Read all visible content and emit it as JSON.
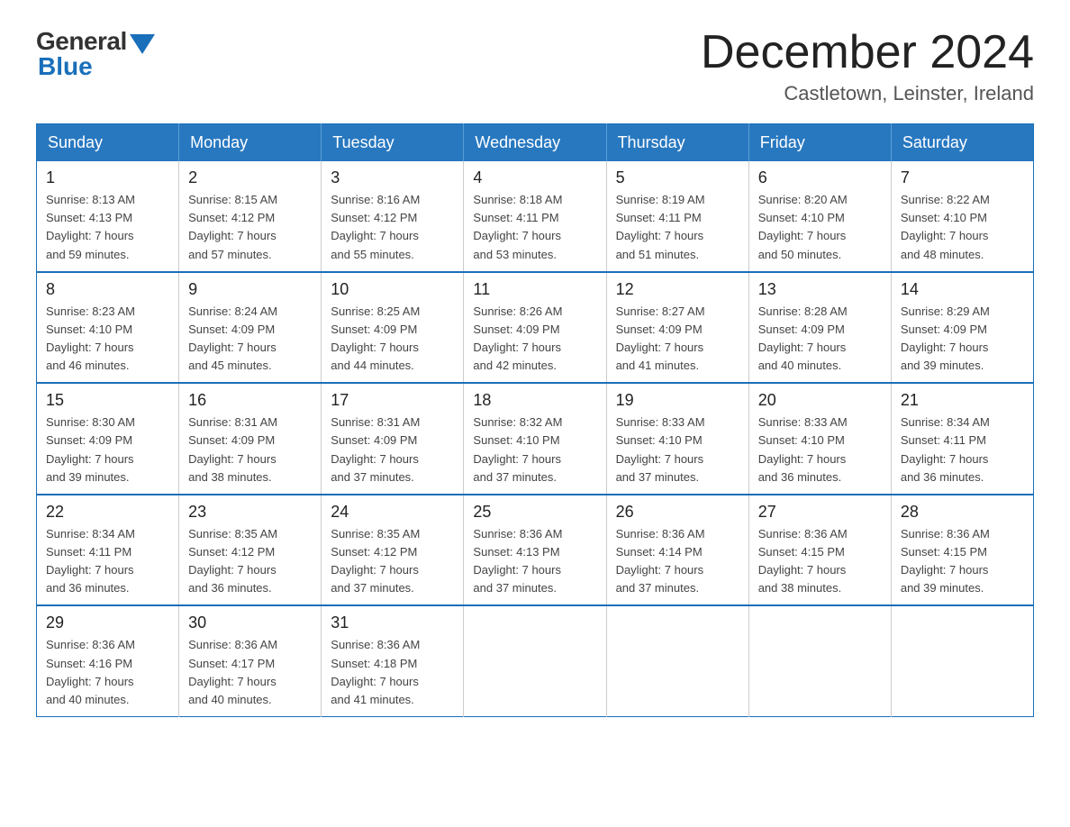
{
  "logo": {
    "general": "General",
    "blue": "Blue"
  },
  "header": {
    "month_year": "December 2024",
    "location": "Castletown, Leinster, Ireland"
  },
  "weekdays": [
    "Sunday",
    "Monday",
    "Tuesday",
    "Wednesday",
    "Thursday",
    "Friday",
    "Saturday"
  ],
  "weeks": [
    [
      {
        "day": "1",
        "sunrise": "8:13 AM",
        "sunset": "4:13 PM",
        "daylight": "7 hours and 59 minutes."
      },
      {
        "day": "2",
        "sunrise": "8:15 AM",
        "sunset": "4:12 PM",
        "daylight": "7 hours and 57 minutes."
      },
      {
        "day": "3",
        "sunrise": "8:16 AM",
        "sunset": "4:12 PM",
        "daylight": "7 hours and 55 minutes."
      },
      {
        "day": "4",
        "sunrise": "8:18 AM",
        "sunset": "4:11 PM",
        "daylight": "7 hours and 53 minutes."
      },
      {
        "day": "5",
        "sunrise": "8:19 AM",
        "sunset": "4:11 PM",
        "daylight": "7 hours and 51 minutes."
      },
      {
        "day": "6",
        "sunrise": "8:20 AM",
        "sunset": "4:10 PM",
        "daylight": "7 hours and 50 minutes."
      },
      {
        "day": "7",
        "sunrise": "8:22 AM",
        "sunset": "4:10 PM",
        "daylight": "7 hours and 48 minutes."
      }
    ],
    [
      {
        "day": "8",
        "sunrise": "8:23 AM",
        "sunset": "4:10 PM",
        "daylight": "7 hours and 46 minutes."
      },
      {
        "day": "9",
        "sunrise": "8:24 AM",
        "sunset": "4:09 PM",
        "daylight": "7 hours and 45 minutes."
      },
      {
        "day": "10",
        "sunrise": "8:25 AM",
        "sunset": "4:09 PM",
        "daylight": "7 hours and 44 minutes."
      },
      {
        "day": "11",
        "sunrise": "8:26 AM",
        "sunset": "4:09 PM",
        "daylight": "7 hours and 42 minutes."
      },
      {
        "day": "12",
        "sunrise": "8:27 AM",
        "sunset": "4:09 PM",
        "daylight": "7 hours and 41 minutes."
      },
      {
        "day": "13",
        "sunrise": "8:28 AM",
        "sunset": "4:09 PM",
        "daylight": "7 hours and 40 minutes."
      },
      {
        "day": "14",
        "sunrise": "8:29 AM",
        "sunset": "4:09 PM",
        "daylight": "7 hours and 39 minutes."
      }
    ],
    [
      {
        "day": "15",
        "sunrise": "8:30 AM",
        "sunset": "4:09 PM",
        "daylight": "7 hours and 39 minutes."
      },
      {
        "day": "16",
        "sunrise": "8:31 AM",
        "sunset": "4:09 PM",
        "daylight": "7 hours and 38 minutes."
      },
      {
        "day": "17",
        "sunrise": "8:31 AM",
        "sunset": "4:09 PM",
        "daylight": "7 hours and 37 minutes."
      },
      {
        "day": "18",
        "sunrise": "8:32 AM",
        "sunset": "4:10 PM",
        "daylight": "7 hours and 37 minutes."
      },
      {
        "day": "19",
        "sunrise": "8:33 AM",
        "sunset": "4:10 PM",
        "daylight": "7 hours and 37 minutes."
      },
      {
        "day": "20",
        "sunrise": "8:33 AM",
        "sunset": "4:10 PM",
        "daylight": "7 hours and 36 minutes."
      },
      {
        "day": "21",
        "sunrise": "8:34 AM",
        "sunset": "4:11 PM",
        "daylight": "7 hours and 36 minutes."
      }
    ],
    [
      {
        "day": "22",
        "sunrise": "8:34 AM",
        "sunset": "4:11 PM",
        "daylight": "7 hours and 36 minutes."
      },
      {
        "day": "23",
        "sunrise": "8:35 AM",
        "sunset": "4:12 PM",
        "daylight": "7 hours and 36 minutes."
      },
      {
        "day": "24",
        "sunrise": "8:35 AM",
        "sunset": "4:12 PM",
        "daylight": "7 hours and 37 minutes."
      },
      {
        "day": "25",
        "sunrise": "8:36 AM",
        "sunset": "4:13 PM",
        "daylight": "7 hours and 37 minutes."
      },
      {
        "day": "26",
        "sunrise": "8:36 AM",
        "sunset": "4:14 PM",
        "daylight": "7 hours and 37 minutes."
      },
      {
        "day": "27",
        "sunrise": "8:36 AM",
        "sunset": "4:15 PM",
        "daylight": "7 hours and 38 minutes."
      },
      {
        "day": "28",
        "sunrise": "8:36 AM",
        "sunset": "4:15 PM",
        "daylight": "7 hours and 39 minutes."
      }
    ],
    [
      {
        "day": "29",
        "sunrise": "8:36 AM",
        "sunset": "4:16 PM",
        "daylight": "7 hours and 40 minutes."
      },
      {
        "day": "30",
        "sunrise": "8:36 AM",
        "sunset": "4:17 PM",
        "daylight": "7 hours and 40 minutes."
      },
      {
        "day": "31",
        "sunrise": "8:36 AM",
        "sunset": "4:18 PM",
        "daylight": "7 hours and 41 minutes."
      },
      null,
      null,
      null,
      null
    ]
  ],
  "labels": {
    "sunrise": "Sunrise:",
    "sunset": "Sunset:",
    "daylight": "Daylight:"
  }
}
